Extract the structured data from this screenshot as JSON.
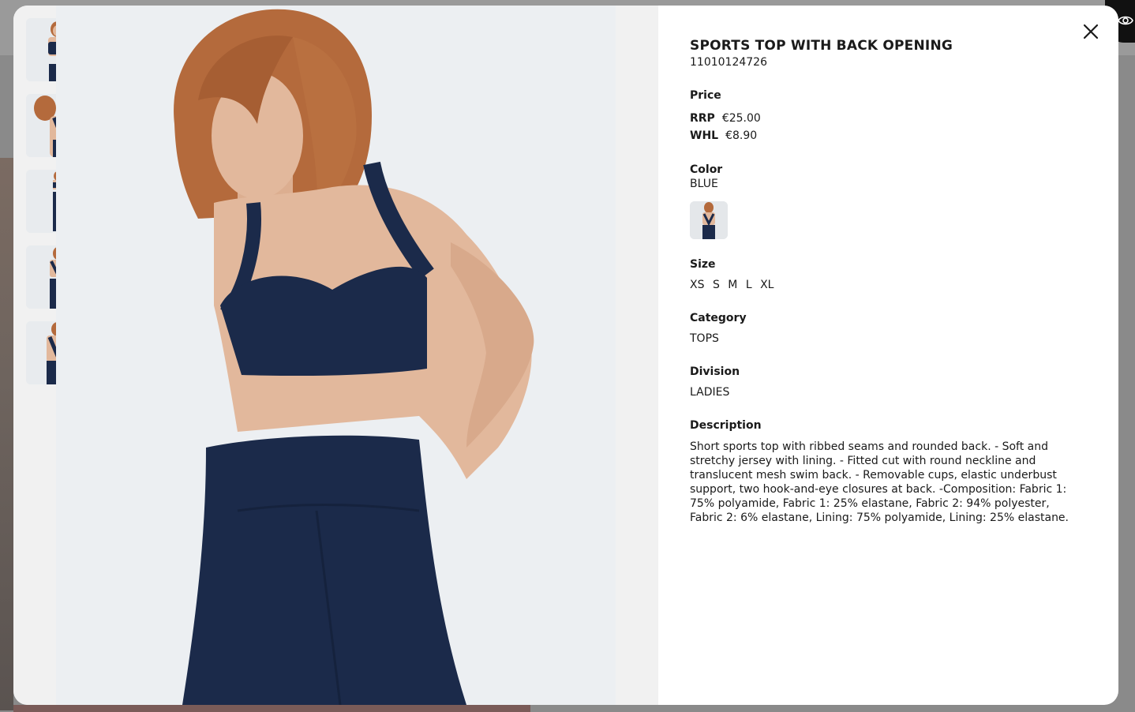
{
  "product": {
    "title": "SPORTS TOP WITH BACK OPENING",
    "sku": "11010124726",
    "price_label": "Price",
    "rrp_label": "RRP",
    "rrp_value": "€25.00",
    "whl_label": "WHL",
    "whl_value": "€8.90",
    "color_label": "Color",
    "color_value": "BLUE",
    "size_label": "Size",
    "sizes": [
      "XS",
      "S",
      "M",
      "L",
      "XL"
    ],
    "category_label": "Category",
    "category_value": "TOPS",
    "division_label": "Division",
    "division_value": "LADIES",
    "description_label": "Description",
    "description": "Short sports top with ribbed seams and rounded back. - Soft and stretchy jersey with lining. - Fitted cut with round neckline and translucent mesh swim back. - Removable cups, elastic underbust support, two hook-and-eye closures at back. -Composition: Fabric 1: 75% polyamide, Fabric 1: 25% elastane, Fabric 2: 94% polyester, Fabric 2: 6% elastane, Lining: 75% polyamide, Lining: 25% elastane."
  },
  "gallery": {
    "thumbnail_count": 5
  },
  "colors": {
    "garment": "#1b2a4a",
    "skin": "#e2b89c",
    "hair": "#b46a3c",
    "photo_bg": "#eceff2"
  },
  "icons": {
    "close": "close-icon",
    "eye": "eye-icon"
  }
}
